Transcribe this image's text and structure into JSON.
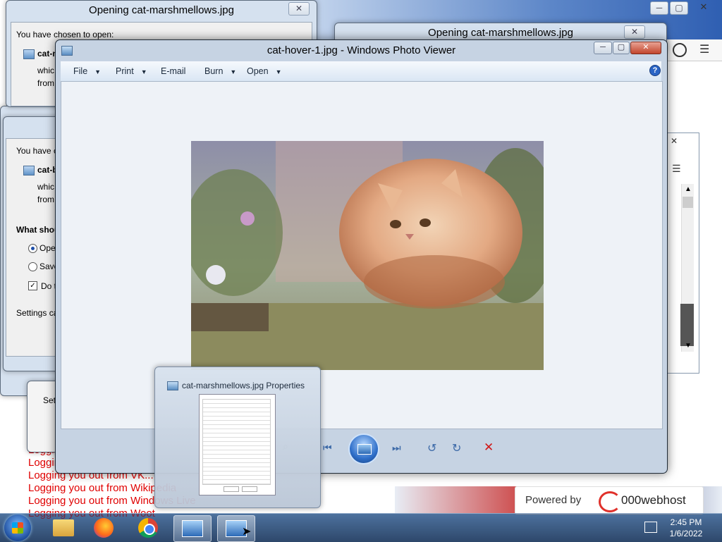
{
  "background": {
    "logout_lines": [
      "Logging you out from VK...",
      "Logging you out from VK...",
      "Logging you out from VK...",
      "Logging you out from Wikipedia",
      "Logging you out from Windows Live",
      "Logging you out from Woot"
    ],
    "powered_by": {
      "label": "Powered by",
      "brand": "000webhost"
    }
  },
  "dialog_top": {
    "title": "Opening cat-marshmellows.jpg",
    "chosen_label": "You have chosen to open:",
    "file_name": "cat-m",
    "which_text": "whic",
    "from_text": "from"
  },
  "dialog_behind": {
    "title": "Opening cat-marshmellows.jpg"
  },
  "dialog_mid": {
    "chosen_label": "You have c",
    "file_name": "cat-b",
    "which_text": "whic",
    "from_text": "from",
    "question": "What shou",
    "open_option": "Ope",
    "save_option": "Save",
    "do_this": "Do t",
    "settings_text": "Settings ca",
    "set_text": "Set"
  },
  "photo_viewer": {
    "title": "cat-hover-1.jpg - Windows Photo Viewer",
    "menu": [
      {
        "label": "File",
        "has_dropdown": true
      },
      {
        "label": "Print",
        "has_dropdown": true
      },
      {
        "label": "E-mail",
        "has_dropdown": false
      },
      {
        "label": "Burn",
        "has_dropdown": true
      },
      {
        "label": "Open",
        "has_dropdown": true
      }
    ],
    "help_glyph": "?",
    "window_controls": {
      "minimize": "─",
      "maximize": "▢",
      "close": "✕"
    }
  },
  "thumbnail_popup": {
    "title": "cat-marshmellows.jpg Properties"
  },
  "taskbar": {
    "time": "2:45 PM",
    "date": "1/6/2022",
    "apps": [
      "windows-explorer",
      "firefox",
      "chrome",
      "photo-viewer",
      "photo-viewer"
    ]
  },
  "colors": {
    "logout_text": "#e00000",
    "taskbar": "#1e3a5f",
    "viewer_accent": "#2a64c5"
  }
}
